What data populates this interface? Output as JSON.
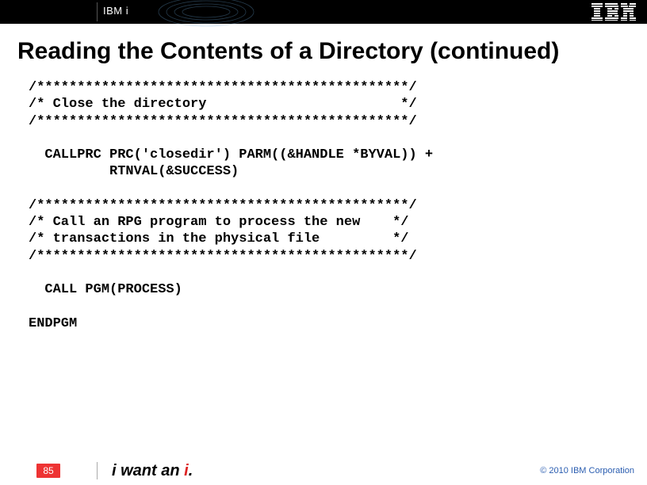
{
  "header": {
    "brand": "IBM i"
  },
  "title": "Reading the Contents of a Directory  (continued)",
  "code": {
    "l01": "/**********************************************/",
    "l02": "/* Close the directory                        */",
    "l03": "/**********************************************/",
    "l04": "",
    "l05": "  CALLPRC PRC('closedir') PARM((&HANDLE *BYVAL)) +",
    "l06": "          RTNVAL(&SUCCESS)",
    "l07": "",
    "l08": "/**********************************************/",
    "l09": "/* Call an RPG program to process the new    */",
    "l10": "/* transactions in the physical file         */",
    "l11": "/**********************************************/",
    "l12": "",
    "l13": "  CALL PGM(PROCESS)",
    "l14": "",
    "l15": "ENDPGM"
  },
  "footer": {
    "page": "85",
    "slogan_prefix": "i want an ",
    "slogan_accent": "i",
    "slogan_suffix": ".",
    "copyright": "© 2010 IBM Corporation"
  }
}
